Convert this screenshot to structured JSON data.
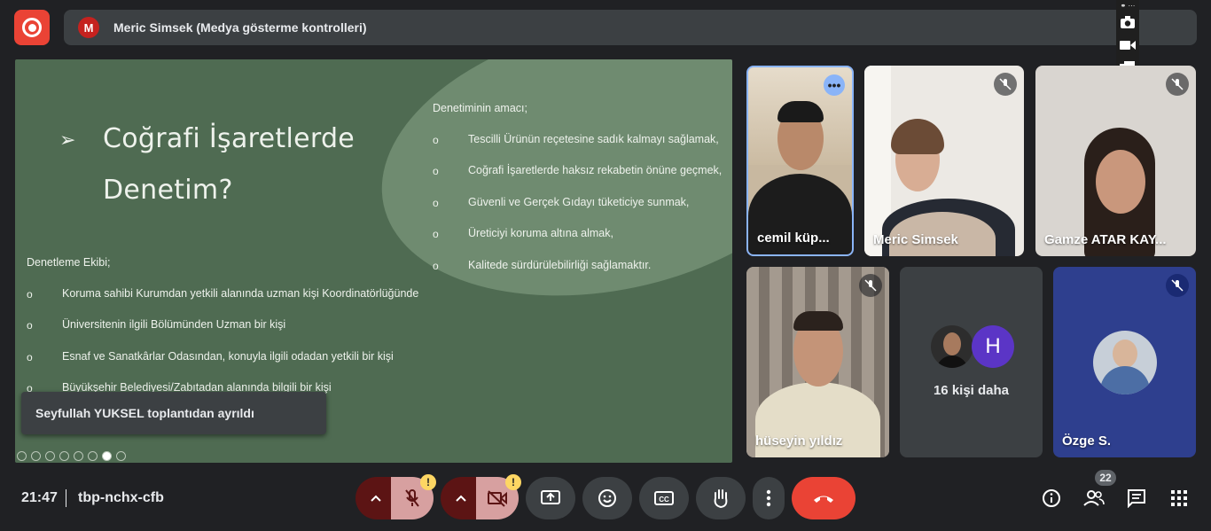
{
  "header": {
    "presenter_initial": "M",
    "presenter_title": "Meric Simsek (Medya gösterme kontrolleri)"
  },
  "slide": {
    "title_line1": "Coğrafi İşaretlerde",
    "title_line2": "Denetim?",
    "purpose_heading": "Denetiminin amacı;",
    "purpose_items": [
      "Tescilli Ürünün reçetesine sadık kalmayı sağlamak,",
      "Coğrafi İşaretlerde haksız rekabetin önüne geçmek,",
      "Güvenli ve Gerçek Gıdayı tüketiciye sunmak,",
      "Üreticiyi koruma altına almak,",
      "Kalitede sürdürülebilirliği sağlamaktır."
    ],
    "team_heading": "Denetleme Ekibi;",
    "team_items": [
      "Koruma sahibi Kurumdan yetkili alanında uzman kişi Koordinatörlüğünde",
      "Üniversitenin ilgili Bölümünden Uzman bir kişi",
      "Esnaf ve Sanatkârlar Odasından, konuyla ilgili odadan yetkili bir kişi",
      "Büyükşehir Belediyesi/Zabıtadan alanında bilgili bir kişi"
    ],
    "bullet": "o"
  },
  "toast": {
    "message": "Seyfullah YUKSEL toplantıdan ayrıldı"
  },
  "participants": [
    {
      "name": "cemil küp...",
      "speaking": true
    },
    {
      "name": "Meric Simsek",
      "muted": true
    },
    {
      "name": "Gamze ATAR KAY...",
      "muted": true
    },
    {
      "name": "hüseyin yıldız",
      "muted": true
    },
    {
      "name": "Özge S.",
      "muted": true
    }
  ],
  "more_tile": {
    "label": "16 kişi daha",
    "avatar_letter": "H"
  },
  "bottom": {
    "time": "21:47",
    "meeting_code": "tbp-nchx-cfb",
    "warning_badge": "!",
    "people_count": "22"
  },
  "colors": {
    "danger": "#ea4335",
    "slide_bg": "#4f6b52",
    "warning": "#fdd663",
    "muted_ctl": "#d7a0a0"
  }
}
